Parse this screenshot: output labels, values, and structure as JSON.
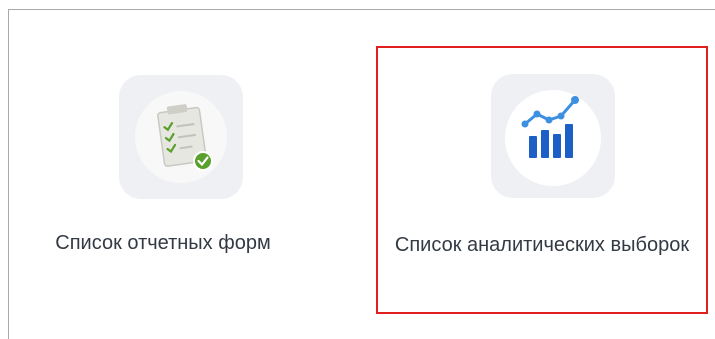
{
  "tiles": [
    {
      "label": "Список отчетных форм",
      "icon": "clipboard-checklist-icon",
      "selected": false
    },
    {
      "label": "Список аналитических выборок",
      "icon": "bar-chart-icon",
      "selected": true
    }
  ],
  "colors": {
    "selection_border": "#e0201d",
    "icon_background": "#eef0f4",
    "chart_blue": "#1b5fc7",
    "check_green": "#5aa02c"
  }
}
